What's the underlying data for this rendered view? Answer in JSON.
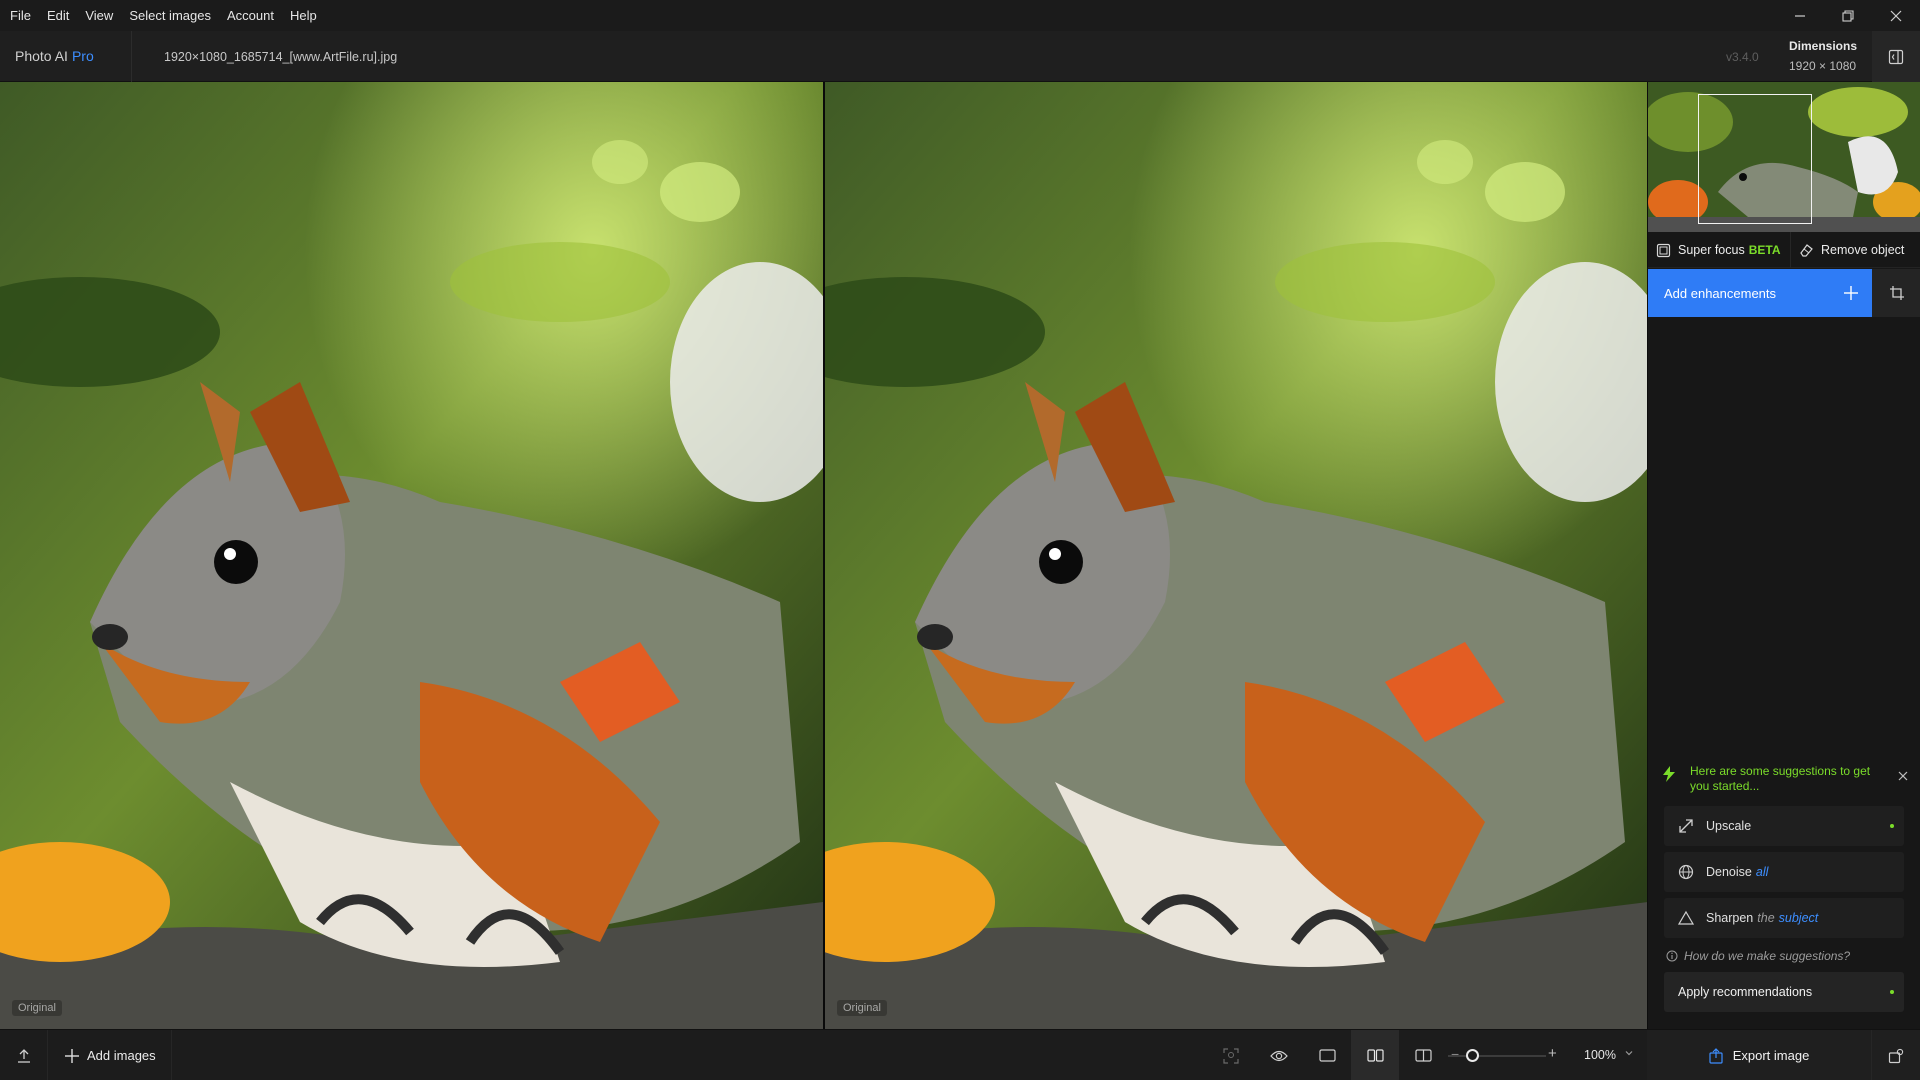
{
  "menu": {
    "items": [
      {
        "label": "File"
      },
      {
        "label": "Edit"
      },
      {
        "label": "View"
      },
      {
        "label": "Select images"
      },
      {
        "label": "Account"
      },
      {
        "label": "Help"
      }
    ]
  },
  "window_controls": {
    "minimize_icon": "minimize-icon",
    "restore_icon": "restore-icon",
    "close_icon": "close-icon"
  },
  "header": {
    "app_name": "Photo AI",
    "app_tier": "Pro",
    "file_name": "1920×1080_1685714_[www.ArtFile.ru].jpg",
    "version": "v3.4.0",
    "dimensions_title": "Dimensions",
    "dimensions_value": "1920 × 1080"
  },
  "canvas": {
    "left_label": "Original",
    "right_label": "Original"
  },
  "panel": {
    "super_focus_label": "Super focus",
    "super_focus_badge": "BETA",
    "remove_object_label": "Remove object",
    "add_enhancements_label": "Add enhancements",
    "suggestions_heading": "Here are some suggestions to get you started...",
    "suggestions": [
      {
        "label": "Upscale",
        "qualifier": "",
        "target": ""
      },
      {
        "label": "Denoise",
        "qualifier": "",
        "target": "all"
      },
      {
        "label": "Sharpen",
        "qualifier": "the",
        "target": "subject"
      }
    ],
    "how_link": "How do we make suggestions?",
    "apply_label": "Apply recommendations"
  },
  "bottom": {
    "add_images_label": "Add images",
    "zoom_value": "100%",
    "zoom_level": 0.25,
    "export_label": "Export image"
  },
  "colors": {
    "accent": "#2f7cf6",
    "highlight_green": "#7bdc2a",
    "background": "#171717"
  }
}
